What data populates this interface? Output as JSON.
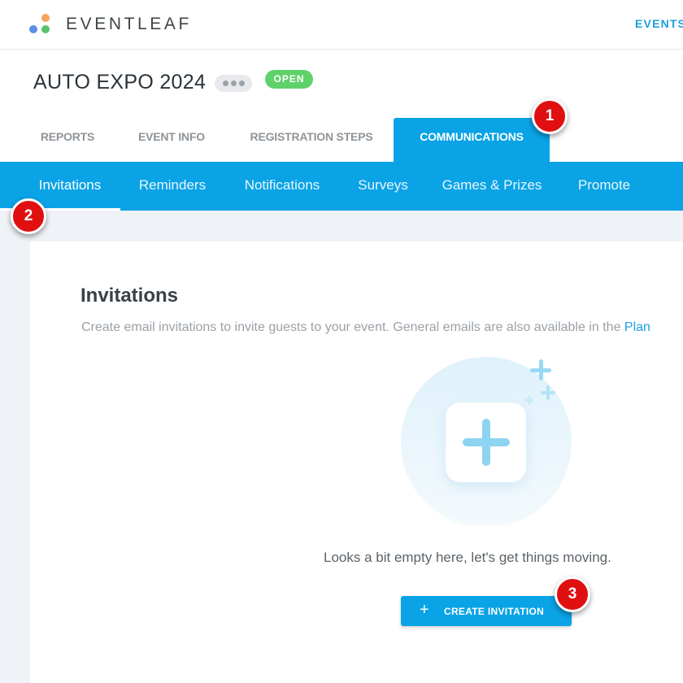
{
  "app": {
    "brand": "EVENTLEAF",
    "top_nav": "EVENTS",
    "colors": {
      "accent": "#0aa3e6",
      "open_badge": "#5fd16a",
      "marker": "#e01010"
    }
  },
  "event": {
    "title": "AUTO EXPO 2024",
    "status": "OPEN"
  },
  "main_tabs": [
    {
      "label": "REPORTS"
    },
    {
      "label": "EVENT INFO"
    },
    {
      "label": "REGISTRATION STEPS"
    },
    {
      "label": "COMMUNICATIONS",
      "active": true
    }
  ],
  "sub_tabs": [
    {
      "label": "Invitations",
      "active": true
    },
    {
      "label": "Reminders"
    },
    {
      "label": "Notifications"
    },
    {
      "label": "Surveys"
    },
    {
      "label": "Games & Prizes"
    },
    {
      "label": "Promote"
    }
  ],
  "content": {
    "title": "Invitations",
    "description": "Create email invitations to invite guests to your event. General emails are also available in the ",
    "description_link": "Plan",
    "empty_message": "Looks a bit empty here, let's get things moving.",
    "create_button": {
      "icon": "plus",
      "label": "CREATE INVITATION"
    }
  },
  "markers": [
    "1",
    "2",
    "3"
  ]
}
